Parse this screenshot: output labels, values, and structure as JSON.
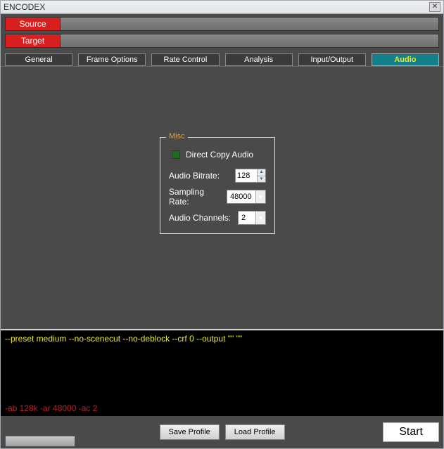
{
  "window": {
    "title": "ENCODEX"
  },
  "files": {
    "source_label": "Source",
    "target_label": "Target",
    "source_path": "",
    "target_path": ""
  },
  "tabs": [
    {
      "label": "General"
    },
    {
      "label": "Frame Options"
    },
    {
      "label": "Rate Control"
    },
    {
      "label": "Analysis"
    },
    {
      "label": "Input/Output"
    },
    {
      "label": "Audio"
    }
  ],
  "misc": {
    "legend": "Misc",
    "direct_copy_label": "Direct Copy Audio",
    "bitrate_label": "Audio Bitrate:",
    "bitrate_value": "128",
    "sampling_label": "Sampling Rate:",
    "sampling_value": "48000",
    "channels_label": "Audio Channels:",
    "channels_value": "2"
  },
  "cmd": {
    "video": "--preset medium --no-scenecut --no-deblock --crf 0 --output \"\" \"\"",
    "audio": "-ab 128k -ar 48000 -ac 2"
  },
  "footer": {
    "save_label": "Save Profile",
    "load_label": "Load Profile",
    "start_label": "Start"
  }
}
